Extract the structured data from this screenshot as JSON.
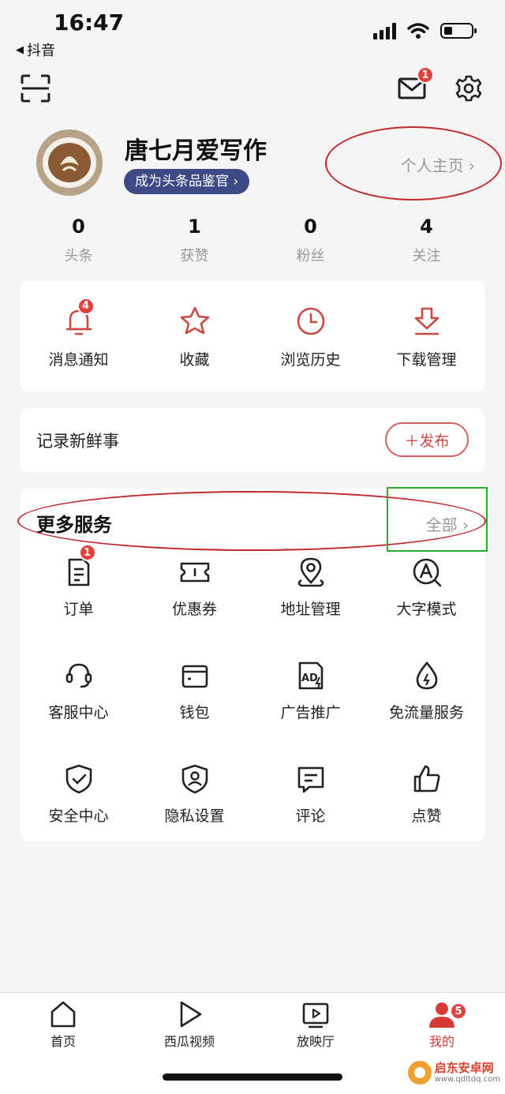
{
  "status_bar": {
    "time": "16:47",
    "back_app": "抖音"
  },
  "header": {
    "mail_badge": "1"
  },
  "profile": {
    "username": "唐七月爱写作",
    "appraiser_badge": "成为头条品鉴官 ›",
    "homepage_link": "个人主页 ›"
  },
  "stats": [
    {
      "value": "0",
      "label": "头条"
    },
    {
      "value": "1",
      "label": "获赞"
    },
    {
      "value": "0",
      "label": "粉丝"
    },
    {
      "value": "4",
      "label": "关注"
    }
  ],
  "quick_actions": [
    {
      "label": "消息通知",
      "icon": "bell-icon",
      "badge": "4"
    },
    {
      "label": "收藏",
      "icon": "star-icon"
    },
    {
      "label": "浏览历史",
      "icon": "clock-icon"
    },
    {
      "label": "下载管理",
      "icon": "download-icon"
    }
  ],
  "post": {
    "label": "记录新鲜事",
    "button": "＋发布"
  },
  "services": {
    "title": "更多服务",
    "all_link": "全部 ›",
    "items": [
      {
        "label": "订单",
        "icon": "order-icon",
        "badge": "1"
      },
      {
        "label": "优惠券",
        "icon": "coupon-icon"
      },
      {
        "label": "地址管理",
        "icon": "location-icon"
      },
      {
        "label": "大字模式",
        "icon": "large-font-icon"
      },
      {
        "label": "客服中心",
        "icon": "headset-icon"
      },
      {
        "label": "钱包",
        "icon": "wallet-icon"
      },
      {
        "label": "广告推广",
        "icon": "ad-icon"
      },
      {
        "label": "免流量服务",
        "icon": "data-drop-icon"
      },
      {
        "label": "安全中心",
        "icon": "shield-check-icon"
      },
      {
        "label": "隐私设置",
        "icon": "privacy-icon"
      },
      {
        "label": "评论",
        "icon": "comment-icon"
      },
      {
        "label": "点赞",
        "icon": "thumbs-up-icon"
      }
    ]
  },
  "tabbar": {
    "tabs": [
      {
        "label": "首页",
        "icon": "home-icon"
      },
      {
        "label": "西瓜视频",
        "icon": "play-icon"
      },
      {
        "label": "放映厅",
        "icon": "tv-play-icon"
      },
      {
        "label": "我的",
        "icon": "user-icon",
        "badge": "5",
        "active": true
      }
    ]
  },
  "watermark": {
    "title": "启东安卓网",
    "url": "www.qdltdq.com"
  },
  "colors": {
    "accent": "#d63a35",
    "badge": "#e0413d",
    "appraiser_bg": "#3e4a85",
    "annotation_red": "#c0272d",
    "annotation_green": "#2fa82f"
  }
}
